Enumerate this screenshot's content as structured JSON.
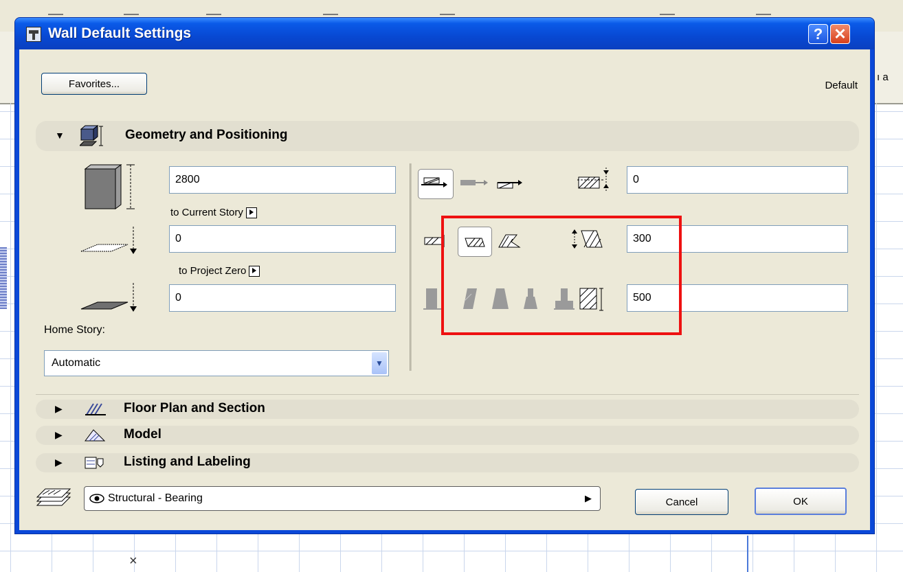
{
  "window": {
    "title": "Wall Default Settings",
    "help_label": "?",
    "close_label": "✕"
  },
  "header": {
    "favorites_label": "Favorites...",
    "default_label": "Default"
  },
  "sections": {
    "geometry": "Geometry and Positioning",
    "floor_plan": "Floor Plan and Section",
    "model": "Model",
    "listing": "Listing and Labeling"
  },
  "geometry": {
    "height_value": "2800",
    "top_link_label": "to Current Story",
    "base_offset_value": "0",
    "base_link_label": "to Project Zero",
    "base_abs_value": "0",
    "home_story_label": "Home Story:",
    "home_story_value": "Automatic",
    "offset_value": "0",
    "thickness_value": "300",
    "inclination_value": "500"
  },
  "footer": {
    "layer_value": "Structural - Bearing",
    "cancel_label": "Cancel",
    "ok_label": "OK"
  },
  "background": {
    "cut_text": "ı a"
  },
  "colors": {
    "title_blue": "#0a48d8",
    "dialog_bg": "#ece9d8",
    "highlight_red": "#ee1111"
  }
}
